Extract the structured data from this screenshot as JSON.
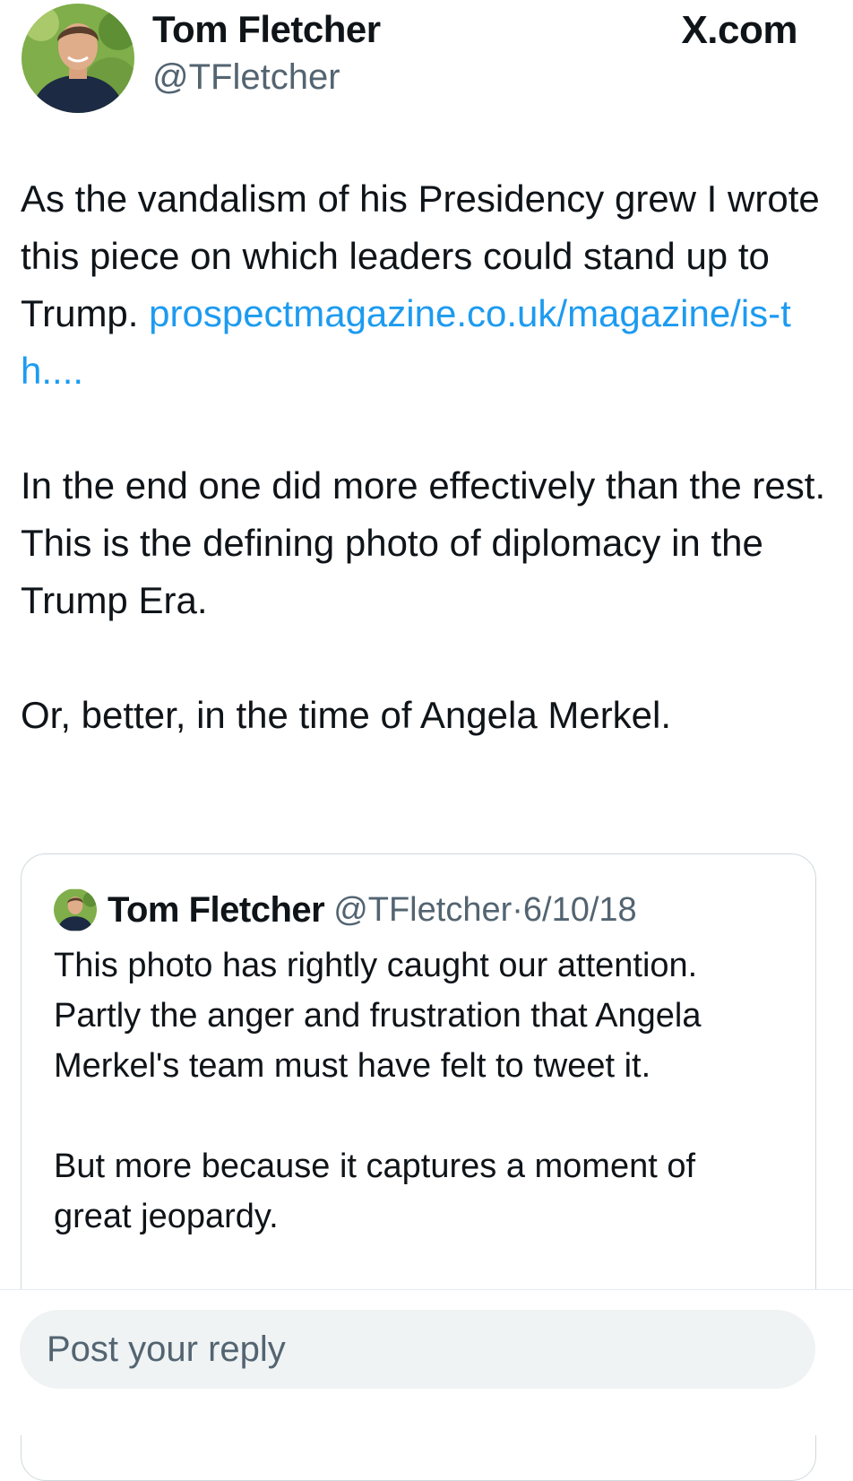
{
  "post": {
    "author_name": "Tom Fletcher",
    "author_handle": "@TFletcher",
    "brand": "X.com",
    "text_1": "As the vandalism of his Presidency grew I wrote this piece on which leaders could stand up to Trump.",
    "link": "prospectmagazine.co.uk/magazine/is-th....",
    "text_2": "In the end one did more effectively than the rest. This is the defining photo of diplomacy in the Trump Era.",
    "text_3": "Or, better, in the time of Angela Merkel."
  },
  "quoted_post": {
    "author_name": "Tom Fletcher",
    "author_handle": "@TFletcher",
    "separator": "·",
    "date": "6/10/18",
    "text_1": "This photo has rightly caught our attention. Partly the anger and frustration that Angela Merkel's team must have felt to tweet it.",
    "text_2": "But more because it captures a moment of great jeopardy."
  },
  "reply": {
    "placeholder": "Post your reply"
  },
  "colors": {
    "link": "#1d9bf0",
    "secondary_text": "#536471",
    "primary_text": "#0f1419",
    "reply_bar_bg": "#eff3f4"
  }
}
